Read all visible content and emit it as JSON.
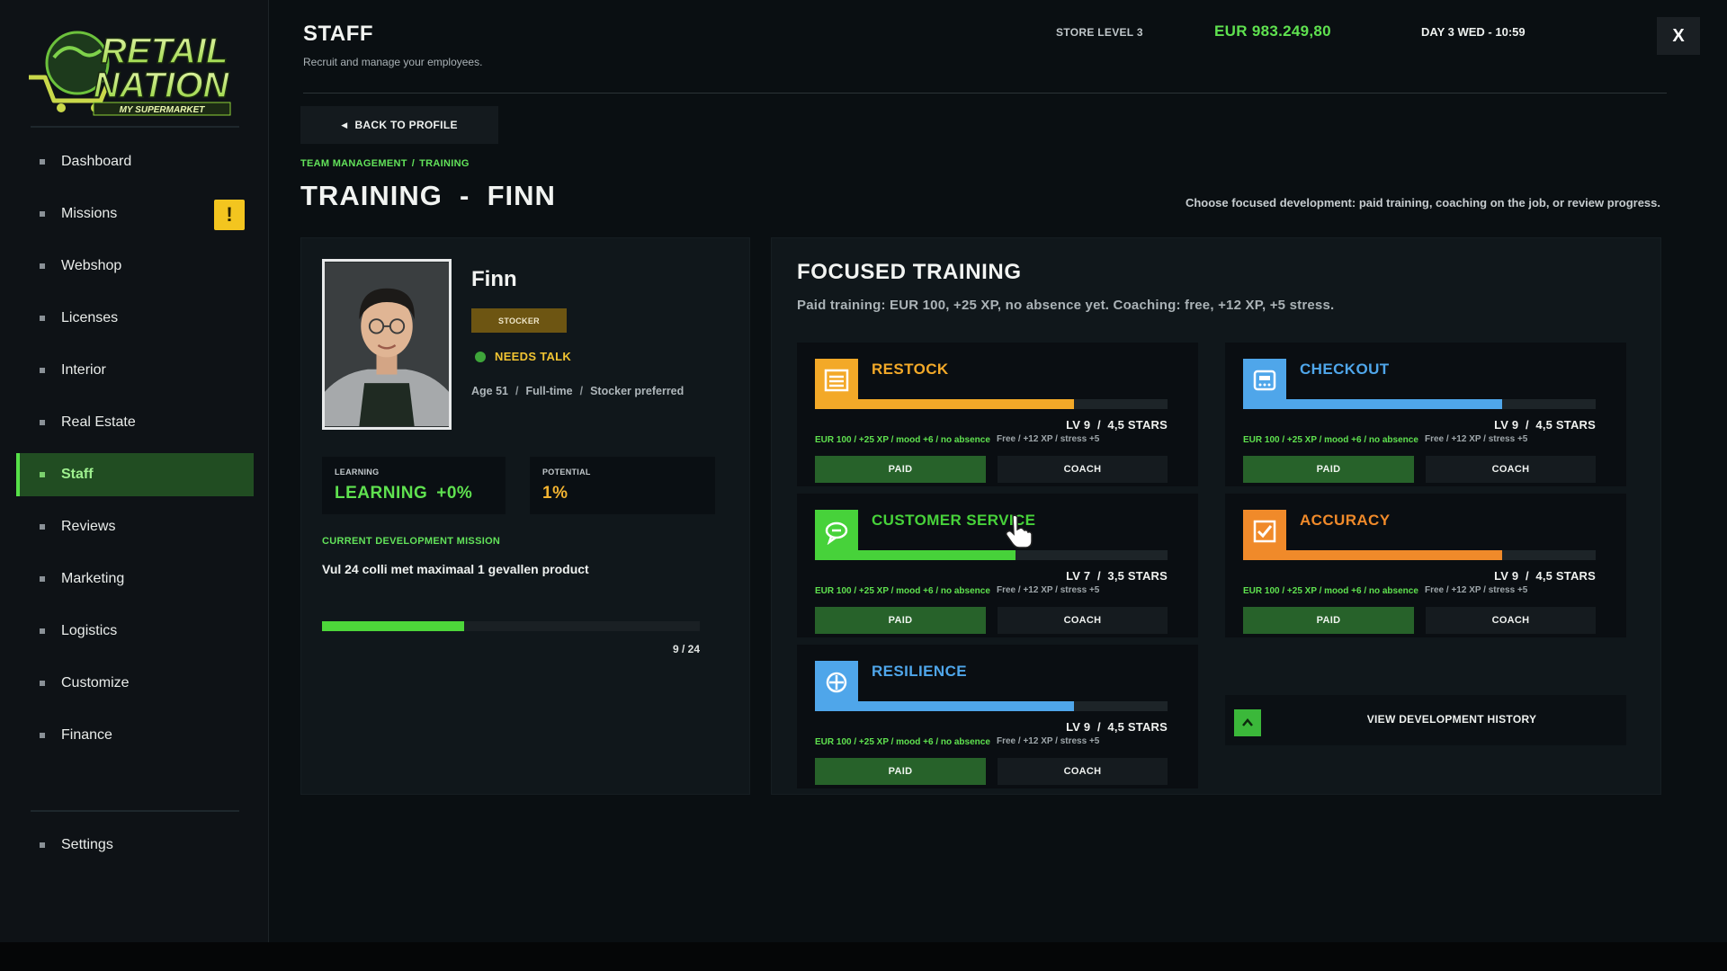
{
  "sidebar": {
    "logo": {
      "line1": "RETAIL",
      "line2": "NATION",
      "tagline": "MY SUPERMARKET"
    },
    "items": [
      {
        "label": "Dashboard"
      },
      {
        "label": "Missions",
        "badge": "!"
      },
      {
        "label": "Webshop"
      },
      {
        "label": "Licenses"
      },
      {
        "label": "Interior"
      },
      {
        "label": "Real Estate"
      },
      {
        "label": "Staff",
        "active": true
      },
      {
        "label": "Reviews"
      },
      {
        "label": "Marketing"
      },
      {
        "label": "Logistics"
      },
      {
        "label": "Customize"
      },
      {
        "label": "Finance"
      }
    ],
    "settings": "Settings"
  },
  "header": {
    "title": "STAFF",
    "subtitle": "Recruit and manage your employees.",
    "store_level": "STORE LEVEL 3",
    "money": "EUR 983.249,80",
    "daytime": "DAY 3  WED  -  10:59",
    "close": "X"
  },
  "nav": {
    "back": "BACK TO PROFILE",
    "back_icon": "triangle-left-icon",
    "breadcrumb": [
      "TEAM MANAGEMENT",
      "TRAINING"
    ],
    "breadcrumb_sep": "/"
  },
  "page": {
    "title": "TRAINING  -  FINN",
    "hint": "Choose focused development: paid training, coaching on the job, or review progress."
  },
  "profile": {
    "name": "Finn",
    "role": "STOCKER",
    "status": "NEEDS TALK",
    "meta": [
      "Age 51",
      "Full-time",
      "Stocker preferred"
    ],
    "meta_sep": "/",
    "learning_label": "LEARNING",
    "learning_value": "LEARNING",
    "learning_delta": "+0%",
    "potential_label": "POTENTIAL",
    "potential_value": "1%",
    "mission_label": "CURRENT DEVELOPMENT MISSION",
    "mission_text": "Vul 24 colli met maximaal 1 gevallen product",
    "mission_progress": 9,
    "mission_total": 24,
    "mission_count": "9 / 24"
  },
  "training": {
    "title": "FOCUSED TRAINING",
    "subtitle": "Paid training: EUR 100, +25 XP, no absence yet. Coaching: free, +12 XP, +5 stress.",
    "skills": [
      {
        "name": "RESTOCK",
        "icon": "restock-icon",
        "color": "#f3a928",
        "progress": 0.735,
        "level": "LV 9  /  4,5 STARS",
        "paid_info": "EUR 100  /  +25 XP  /  mood +6  /  no absence",
        "coach_info": "Free  /  +12 XP  /  stress +5",
        "paid": "PAID",
        "coach": "COACH"
      },
      {
        "name": "CHECKOUT",
        "icon": "checkout-icon",
        "color": "#4fa6ea",
        "progress": 0.735,
        "level": "LV 9  /  4,5 STARS",
        "paid_info": "EUR 100  /  +25 XP  /  mood +6  /  no absence",
        "coach_info": "Free  /  +12 XP  /  stress +5",
        "paid": "PAID",
        "coach": "COACH"
      },
      {
        "name": "CUSTOMER SERVICE",
        "icon": "customer-service-icon",
        "color": "#47d23a",
        "progress": 0.57,
        "level": "LV 7  /  3,5 STARS",
        "paid_info": "EUR 100  /  +25 XP  /  mood +6  /  no absence",
        "coach_info": "Free  /  +12 XP  /  stress +5",
        "paid": "PAID",
        "coach": "COACH"
      },
      {
        "name": "ACCURACY",
        "icon": "accuracy-icon",
        "color": "#f08a2a",
        "progress": 0.735,
        "level": "LV 9  /  4,5 STARS",
        "paid_info": "EUR 100  /  +25 XP  /  mood +6  /  no absence",
        "coach_info": "Free  /  +12 XP  /  stress +5",
        "paid": "PAID",
        "coach": "COACH"
      },
      {
        "name": "RESILIENCE",
        "icon": "resilience-icon",
        "color": "#4fa6ea",
        "progress": 0.735,
        "level": "LV 9  /  4,5 STARS",
        "paid_info": "EUR 100  /  +25 XP  /  mood +6  /  no absence",
        "coach_info": "Free  /  +12 XP  /  stress +5",
        "paid": "PAID",
        "coach": "COACH"
      }
    ],
    "history_label": "VIEW DEVELOPMENT HISTORY",
    "history_icon": "chevron-up-icon"
  },
  "colors": {
    "accent_green": "#5fe14f",
    "status_amber": "#f1c432",
    "active_nav": "#214d22"
  }
}
